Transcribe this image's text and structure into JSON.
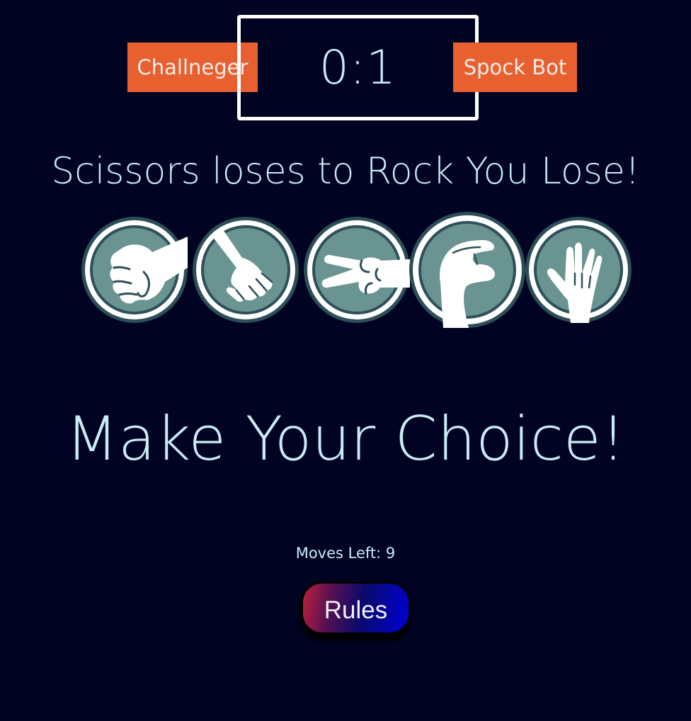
{
  "score": {
    "player_name": "Challneger",
    "value": "0:1",
    "opponent_name": "Spock Bot"
  },
  "result_text": "Scissors loses to Rock You Lose!",
  "choices": [
    {
      "id": "rock",
      "icon": "fist-icon"
    },
    {
      "id": "paper",
      "icon": "open-hand-icon"
    },
    {
      "id": "scissors",
      "icon": "scissors-hand-icon"
    },
    {
      "id": "lizard",
      "icon": "lizard-hand-icon"
    },
    {
      "id": "spock",
      "icon": "vulcan-salute-icon"
    }
  ],
  "prompt": "Make Your Choice!",
  "moves_left": "Moves Left: 9",
  "rules_button": "Rules",
  "colors": {
    "background": "#010322",
    "text": "#c9ecf6",
    "label_bg": "#e96030",
    "choice_face": "#6a9491",
    "choice_border": "#2c4e57"
  }
}
